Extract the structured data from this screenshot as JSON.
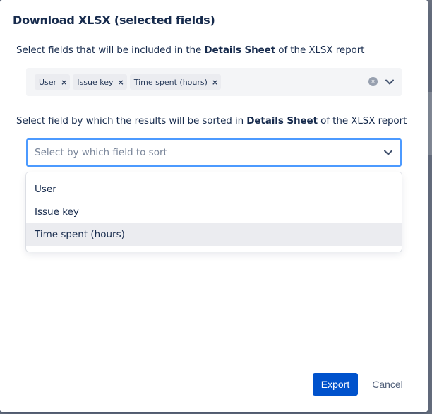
{
  "dialog": {
    "title": "Download XLSX (selected fields)"
  },
  "fields_section": {
    "label_prefix": "Select fields that will be included in the ",
    "label_bold": "Details Sheet",
    "label_suffix": " of the XLSX report",
    "selected_tags": [
      "User",
      "Issue key",
      "Time spent (hours)"
    ],
    "remove_glyph": "×",
    "clear_glyph": "×"
  },
  "sort_section": {
    "label_prefix": "Select field by which the results will be sorted in ",
    "label_bold": "Details Sheet",
    "label_suffix": " of the XLSX report",
    "placeholder": "Select by which field to sort",
    "options": [
      "User",
      "Issue key",
      "Time spent (hours)"
    ],
    "highlighted_option": "Time spent (hours)"
  },
  "footer": {
    "export_label": "Export",
    "cancel_label": "Cancel"
  },
  "colors": {
    "primary_button": "#0052cc",
    "focus_border": "#4c9aff",
    "option_hover": "#ebecf0"
  },
  "icons": {
    "dropdown": "chevron-down-icon",
    "clear": "clear-icon",
    "remove": "close-icon"
  }
}
